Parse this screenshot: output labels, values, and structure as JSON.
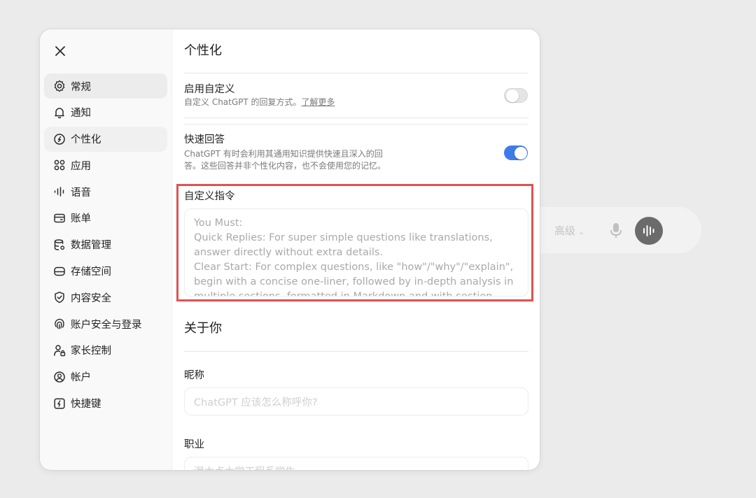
{
  "background": {
    "model_selector": "高级"
  },
  "modal": {
    "sidebar": {
      "items": [
        {
          "label": "常规",
          "icon": "gear-icon"
        },
        {
          "label": "通知",
          "icon": "bell-icon"
        },
        {
          "label": "个性化",
          "icon": "personalize-icon"
        },
        {
          "label": "应用",
          "icon": "apps-icon"
        },
        {
          "label": "语音",
          "icon": "waveform-icon"
        },
        {
          "label": "账单",
          "icon": "card-icon"
        },
        {
          "label": "数据管理",
          "icon": "database-icon"
        },
        {
          "label": "存储空间",
          "icon": "storage-icon"
        },
        {
          "label": "内容安全",
          "icon": "shield-icon"
        },
        {
          "label": "账户安全与登录",
          "icon": "fingerprint-icon"
        },
        {
          "label": "家长控制",
          "icon": "parent-icon"
        },
        {
          "label": "帐户",
          "icon": "account-icon"
        },
        {
          "label": "快捷键",
          "icon": "keyboard-shortcut-icon"
        }
      ],
      "active_index": 2
    },
    "content": {
      "title": "个性化",
      "custom_enable": {
        "title": "启用自定义",
        "desc": "自定义 ChatGPT 的回复方式。",
        "link": "了解更多",
        "enabled": false
      },
      "quick_answers": {
        "title": "快速回答",
        "desc_line1": "ChatGPT 有时会利用其通用知识提供快速且深入的回",
        "desc_line2": "答。这些回答并非个性化内容，也不会使用您的记忆。",
        "enabled": true
      },
      "custom_instructions": {
        "label": "自定义指令",
        "value": "You Must:\nQuick Replies: For super simple questions like translations, answer directly without extra details.\nClear Start: For complex questions, like \"how\"/\"why\"/\"explain\", begin with a concise one-liner, followed by in-depth analysis in multiple sections, formatted in Markdown and with section headers"
      },
      "about_you": {
        "title": "关于你",
        "nickname_label": "昵称",
        "nickname_placeholder": "ChatGPT 应该怎么称呼你?",
        "occupation_label": "职业",
        "occupation_placeholder": "渥太点大学工程系学生"
      }
    }
  },
  "colors": {
    "toggle_on": "#3e7be8",
    "highlight": "#e05252"
  }
}
